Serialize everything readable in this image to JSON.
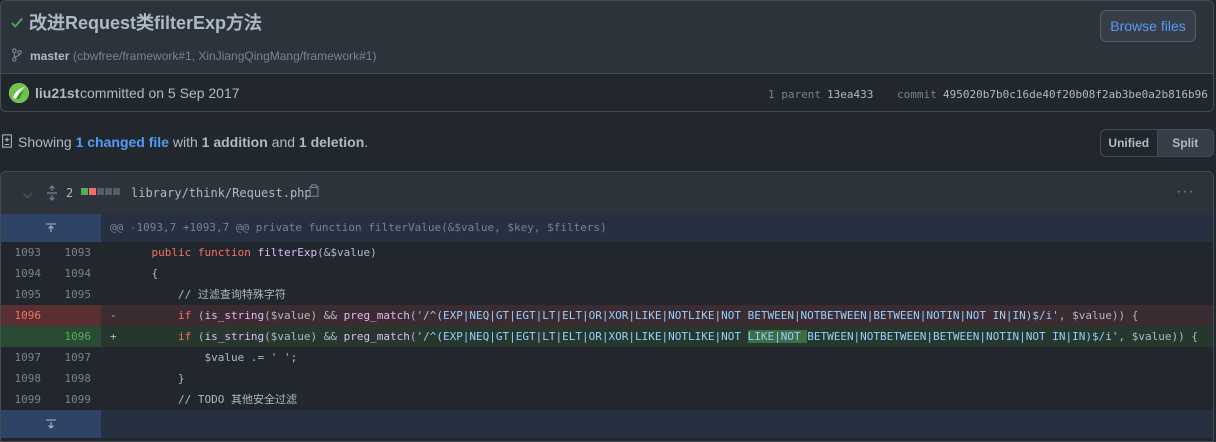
{
  "commit": {
    "title": "改进Request类filterExp方法",
    "browse_label": "Browse files",
    "branch": "master",
    "refs": "(cbwfree/framework#1, XinJiangQingMang/framework#1)",
    "author": "liu21st",
    "committed_text": "committed on 5 Sep 2017",
    "parent_label": "1 parent",
    "parent_sha": "13ea433",
    "commit_label": "commit",
    "commit_sha": "495020b7b0c16de40f20b08f2ab3be0a2b816b96"
  },
  "summary": {
    "prefix": "Showing ",
    "changed_files": "1 changed file",
    "with": " with ",
    "additions": "1 addition",
    "and": " and ",
    "deletions": "1 deletion",
    "suffix": "."
  },
  "view_toggle": {
    "unified": "Unified",
    "split": "Split",
    "active": "split"
  },
  "file": {
    "change_count": "2",
    "path": "library/think/Request.php",
    "hunk_header": "@@ -1093,7 +1093,7 @@ private function filterValue(&$value, $key, $filters)",
    "lines": [
      {
        "old": "1093",
        "new": "1093",
        "code": "    public function filterExp(&$value)"
      },
      {
        "old": "1094",
        "new": "1094",
        "code": "    {"
      },
      {
        "old": "1095",
        "new": "1095",
        "code": "        // 过滤查询特殊字符"
      },
      {
        "old": "1096",
        "new": "",
        "sign": "-",
        "code": "        if (is_string($value) && preg_match('/^(EXP|NEQ|GT|EGT|LT|ELT|OR|XOR|LIKE|NOTLIKE|NOT BETWEEN|NOTBETWEEN|BETWEEN|NOTIN|NOT IN|IN)$/i', $value)) {"
      },
      {
        "old": "",
        "new": "1096",
        "sign": "+",
        "code": "        if (is_string($value) && preg_match('/^(EXP|NEQ|GT|EGT|LT|ELT|OR|XOR|LIKE|NOTLIKE|NOT LIKE|NOT BETWEEN|NOTBETWEEN|BETWEEN|NOTIN|NOT IN|IN)$/i', $value)) {"
      },
      {
        "old": "1097",
        "new": "1097",
        "code": "            $value .= ' ';"
      },
      {
        "old": "1098",
        "new": "1098",
        "code": "        }"
      },
      {
        "old": "1099",
        "new": "1099",
        "code": "        // TODO 其他安全过滤"
      }
    ]
  },
  "colors": {
    "accent": "#539bf5",
    "add": "#57ab5a",
    "del": "#f47067"
  }
}
